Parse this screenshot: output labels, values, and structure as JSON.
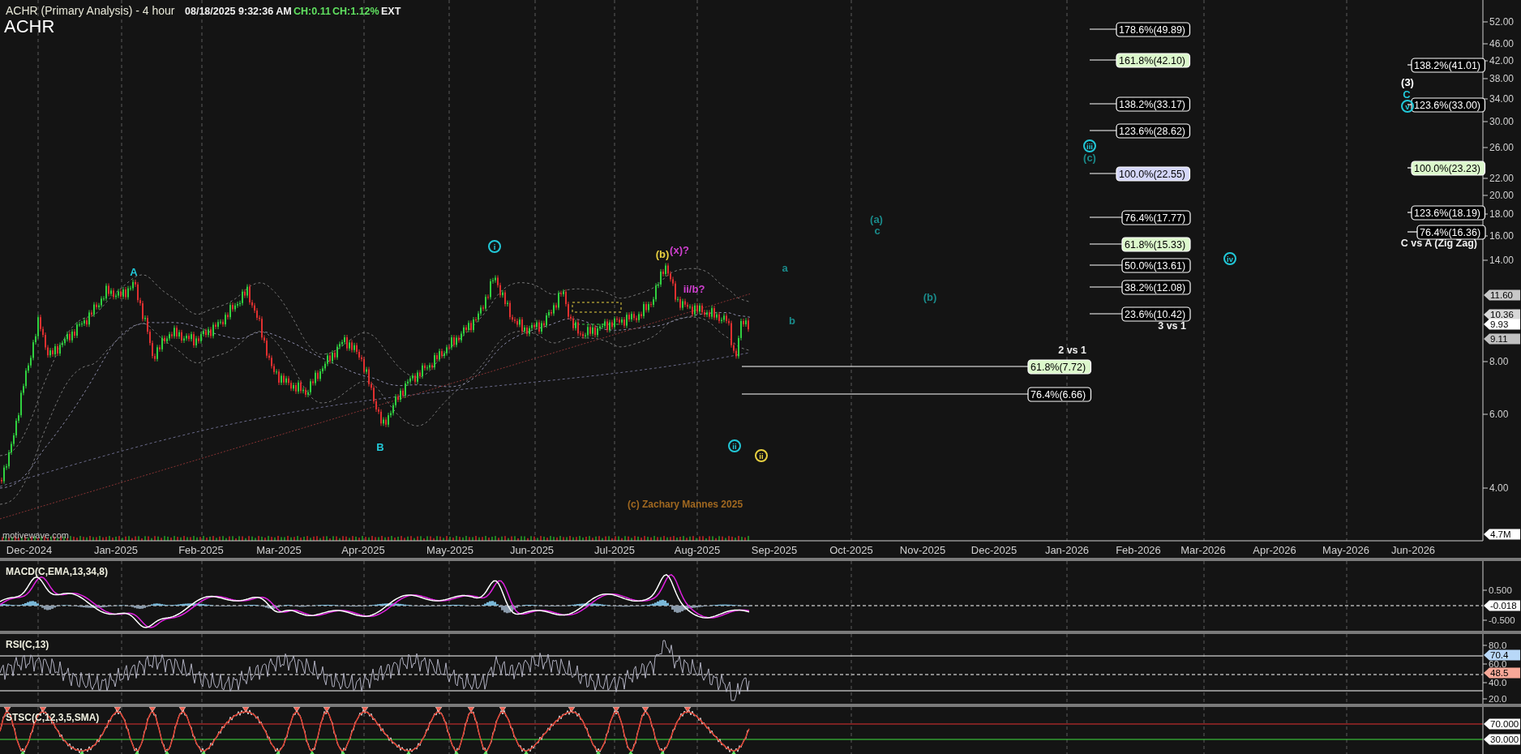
{
  "header": {
    "title": "ACHR (Primary Analysis) - 4 hour",
    "timestamp": "08/18/2025 9:32:36 AM",
    "change": "CH:0.11",
    "change_percent": "CH:1.12%",
    "session": "EXT",
    "symbol": "ACHR"
  },
  "price_chart": {
    "price_axis": [
      "52.00",
      "46.00",
      "42.00",
      "38.00",
      "34.00",
      "30.00",
      "26.00",
      "22.00",
      "20.00",
      "18.00",
      "16.00",
      "14.00",
      "8.00",
      "6.00",
      "4.00"
    ],
    "price_tags": [
      {
        "value": "11.60",
        "color": "#c8c8c8"
      },
      {
        "value": "10.36",
        "color": "#d8d8d8"
      },
      {
        "value": "9.93",
        "color": "#ffffff"
      },
      {
        "value": "9.11",
        "color": "#c0c0c0"
      },
      {
        "value": "4.7M",
        "color": "#ffffff"
      }
    ],
    "time_axis": [
      "Dec-2024",
      "Jan-2025",
      "Feb-2025",
      "Mar-2025",
      "Apr-2025",
      "May-2025",
      "Jun-2025",
      "Jul-2025",
      "Aug-2025",
      "Sep-2025",
      "Oct-2025",
      "Nov-2025",
      "Dec-2025",
      "Jan-2026",
      "Feb-2026",
      "Mar-2026",
      "Apr-2026",
      "May-2026",
      "Jun-2026"
    ],
    "fib_levels": [
      {
        "text": "178.6%(49.89)",
        "color": "#000000"
      },
      {
        "text": "161.8%(42.10)",
        "color": "#dcf8cc"
      },
      {
        "text": "138.2%(33.17)",
        "color": "#000000"
      },
      {
        "text": "123.6%(28.62)",
        "color": "#000000"
      },
      {
        "text": "100.0%(22.55)",
        "color": "#d4d6f8"
      },
      {
        "text": "76.4%(17.77)",
        "color": "#000000"
      },
      {
        "text": "61.8%(15.33)",
        "color": "#dcf8cc"
      },
      {
        "text": "50.0%(13.61)",
        "color": "#000000"
      },
      {
        "text": "38.2%(12.08)",
        "color": "#000000"
      },
      {
        "text": "23.6%(10.42)",
        "color": "#000000"
      },
      {
        "text": "61.8%(7.72)",
        "color": "#dcf8cc"
      },
      {
        "text": "76.4%(6.66)",
        "color": "#000000"
      },
      {
        "text": "138.2%(41.01)",
        "color": "#000000"
      },
      {
        "text": "123.6%(33.00)",
        "color": "#000000"
      },
      {
        "text": "100.0%(23.23)",
        "color": "#dcf8cc"
      },
      {
        "text": "123.6%(18.19)",
        "color": "#000000"
      },
      {
        "text": "76.4%(16.36)",
        "color": "#000000"
      }
    ],
    "notes": [
      "C vs A (Zig Zag)",
      "3 vs 1",
      "2 vs 1"
    ],
    "wave_labels": [
      {
        "text": "(3)",
        "kind": "letter",
        "color": "#ffffff"
      },
      {
        "text": "C",
        "kind": "letter",
        "color": "#22c8d8"
      },
      {
        "text": "v",
        "kind": "circled",
        "color": "#22c8d8"
      },
      {
        "text": "iii",
        "kind": "circled",
        "color": "#22c8d8"
      },
      {
        "text": "(c)",
        "kind": "letter",
        "color": "#1a8a8a"
      },
      {
        "text": "(a)",
        "kind": "letter",
        "color": "#1a8a8a"
      },
      {
        "text": "c",
        "kind": "letter",
        "color": "#1a8a8a"
      },
      {
        "text": "i",
        "kind": "circled",
        "color": "#22c8d8"
      },
      {
        "text": "(b)",
        "kind": "letter",
        "color": "#e8d040"
      },
      {
        "text": "(x)?",
        "kind": "letter",
        "color": "#d040d0"
      },
      {
        "text": "iv",
        "kind": "circled",
        "color": "#22c8d8"
      },
      {
        "text": "a",
        "kind": "letter",
        "color": "#1a8a8a"
      },
      {
        "text": "A",
        "kind": "letter",
        "color": "#22c8d8"
      },
      {
        "text": "ii/b?",
        "kind": "letter",
        "color": "#d040d0"
      },
      {
        "text": "(b)",
        "kind": "letter",
        "color": "#1a8a8a"
      },
      {
        "text": "b",
        "kind": "letter",
        "color": "#1a8a8a"
      },
      {
        "text": "ii",
        "kind": "circled",
        "color": "#22c8d8"
      },
      {
        "text": "B",
        "kind": "letter",
        "color": "#22c8d8"
      },
      {
        "text": "ii",
        "kind": "circled",
        "color": "#e8d040"
      }
    ],
    "credit": "(c) Zachary Mannes 2025",
    "source": "motivewave.com"
  },
  "indicators": [
    {
      "kind": "macd",
      "label": "MACD(C,EMA,13,34,8)",
      "axis": [
        "0.500",
        "-0.500"
      ],
      "tags": [
        {
          "value": "-0.018",
          "color": "#ffffff"
        }
      ]
    },
    {
      "kind": "rsi",
      "label": "RSI(C,13)",
      "axis": [
        "80.0",
        "60.0",
        "40.0",
        "20.0"
      ],
      "tags": [
        {
          "value": "70.4",
          "color": "#b8d8f8"
        },
        {
          "value": "48.5",
          "color": "#f8a898"
        }
      ]
    },
    {
      "kind": "stochastic",
      "label": "STSC(C,12,3,5,SMA)",
      "tags": [
        {
          "value": "70.000",
          "color": "#ffffff"
        },
        {
          "value": "30.000",
          "color": "#ffffff"
        }
      ]
    }
  ]
}
